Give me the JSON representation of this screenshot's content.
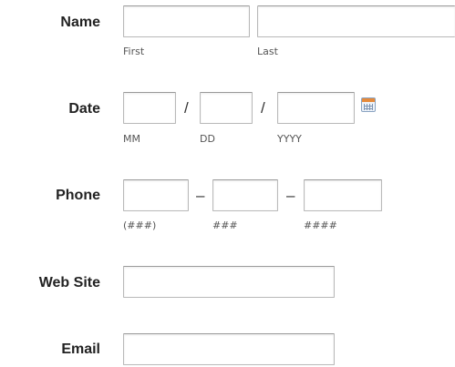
{
  "name": {
    "label": "Name",
    "first_value": "",
    "first_sub": "First",
    "last_value": "",
    "last_sub": "Last"
  },
  "date": {
    "label": "Date",
    "separator": "/",
    "mm_value": "",
    "mm_sub": "MM",
    "dd_value": "",
    "dd_sub": "DD",
    "yyyy_value": "",
    "yyyy_sub": "YYYY",
    "calendar_icon": "calendar-icon"
  },
  "phone": {
    "label": "Phone",
    "separator": "–",
    "area_value": "",
    "area_sub": "(###)",
    "prefix_value": "",
    "prefix_sub": "###",
    "line_value": "",
    "line_sub": "####"
  },
  "website": {
    "label": "Web Site",
    "value": ""
  },
  "email": {
    "label": "Email",
    "value": ""
  }
}
